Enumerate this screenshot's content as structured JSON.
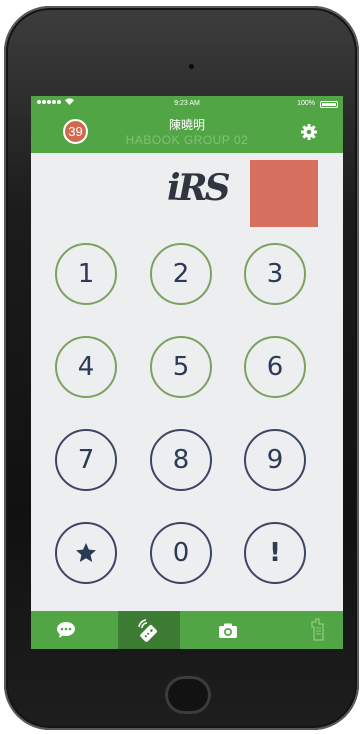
{
  "status_bar": {
    "time": "9:23 AM",
    "battery": "100%"
  },
  "header": {
    "badge_count": "39",
    "name": "陳曉明",
    "group": "HABOOK GROUP 02"
  },
  "logo_text": "iRS",
  "colors": {
    "green": "#52a545",
    "green_dark": "#3d7d33",
    "response_box": "#d8705f",
    "badge": "#cf6a4e"
  },
  "keypad": {
    "keys": [
      "1",
      "2",
      "3",
      "4",
      "5",
      "6",
      "7",
      "8",
      "9",
      "0",
      "!"
    ],
    "star_icon": "star-icon"
  },
  "tabs": [
    {
      "icon": "chat-icon"
    },
    {
      "icon": "remote-control-icon",
      "active": true
    },
    {
      "icon": "camera-icon"
    },
    {
      "icon": "hand-raise-icon"
    }
  ]
}
